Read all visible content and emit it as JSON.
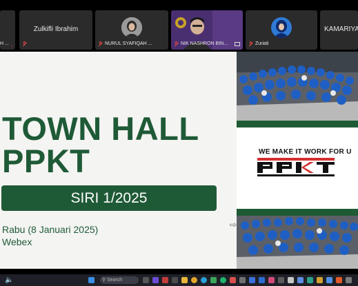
{
  "participants": [
    {
      "name": "H ...",
      "kind": "name-only-partial"
    },
    {
      "name": "Zulkifli Ibrahim",
      "kind": "name-only"
    },
    {
      "name": "NURUL SYAFIQAH ...",
      "kind": "video"
    },
    {
      "name": "NIK NASHRON BIN...",
      "kind": "video"
    },
    {
      "name": "Zuriati",
      "kind": "video"
    },
    {
      "name": "KAMARIYA",
      "kind": "name-only-partial"
    }
  ],
  "slide": {
    "title_line1": "TOWN HALL",
    "title_line2": "PPKT",
    "series": "SIRI 1/2025",
    "date": "Rabu (8 Januari 2025)",
    "platform": "Webex",
    "tagline": "WE MAKE IT WORK FOR U",
    "logo_text": "PPKT",
    "brand_green": "#1f5a37",
    "brand_red": "#d32f2f"
  },
  "taskbar": {
    "search_placeholder": "Search",
    "icons": [
      "speaker-icon",
      "windows-start-icon",
      "search-icon",
      "file-explorer-icon",
      "edge-icon",
      "chrome-icon",
      "webex-icon",
      "store-icon",
      "mail-icon"
    ]
  }
}
